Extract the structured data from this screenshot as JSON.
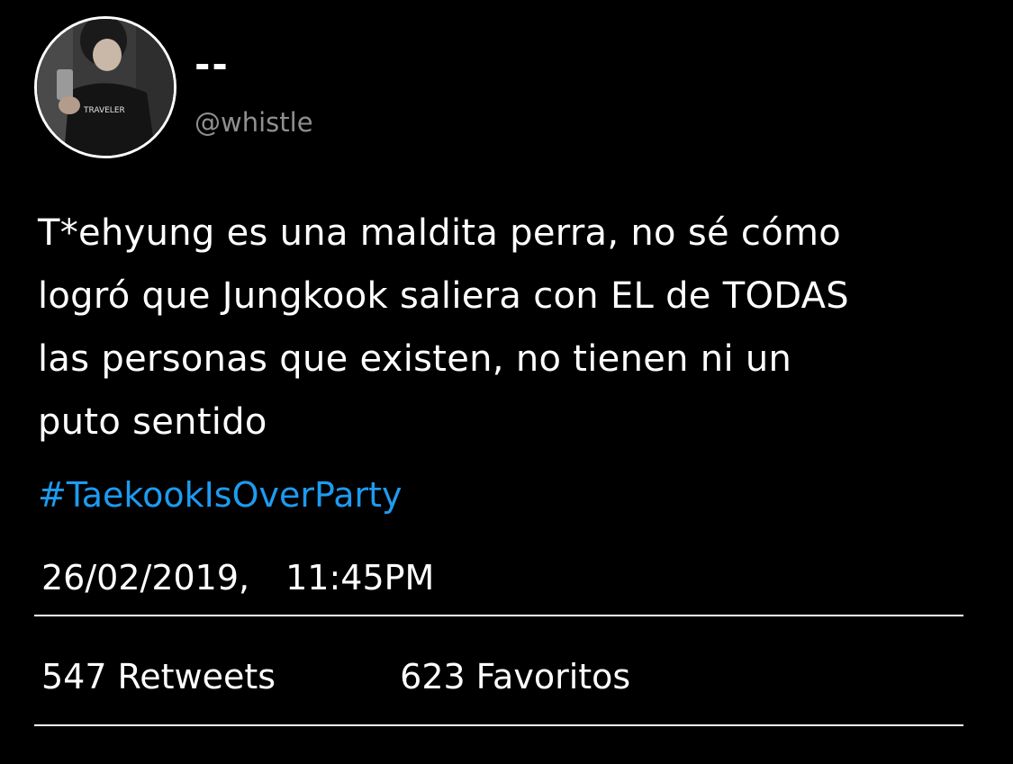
{
  "profile": {
    "display_name": "--",
    "handle": "@whistle",
    "avatar_shirt_text": "TRAVELER"
  },
  "tweet": {
    "lines": [
      "T*ehyung es una maldita perra, no sé cómo",
      "logró que Jungkook saliera con EL de TODAS",
      "las personas que existen, no tienen ni un",
      "puto sentido"
    ],
    "hashtag": "#TaekookIsOverParty",
    "date": "26/02/2019,",
    "time": "11:45PM"
  },
  "stats": {
    "retweets_count": "547",
    "retweets_label": "Retweets",
    "favorites_count": "623",
    "favorites_label": "Favoritos"
  },
  "colors": {
    "background": "#000000",
    "text": "#ffffff",
    "handle": "#8f8f8f",
    "hashtag": "#1d9bf0"
  }
}
